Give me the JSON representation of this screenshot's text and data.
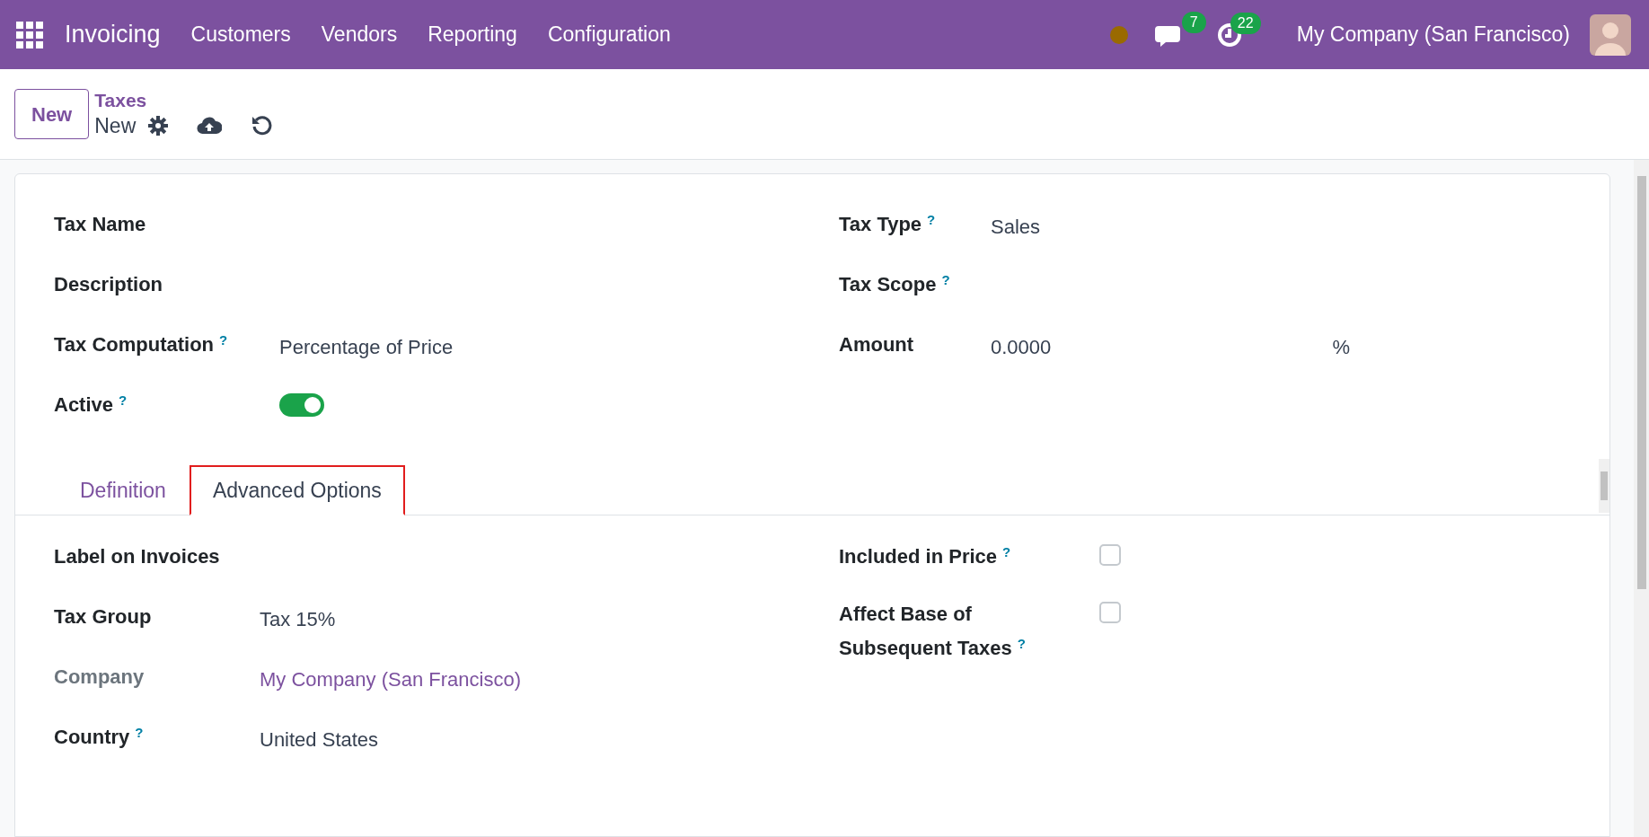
{
  "navbar": {
    "app_name": "Invoicing",
    "menu": [
      "Customers",
      "Vendors",
      "Reporting",
      "Configuration"
    ],
    "messages_count": "7",
    "activities_count": "22",
    "company": "My Company (San Francisco)"
  },
  "control_panel": {
    "new_button": "New",
    "breadcrumb": "Taxes",
    "record": "New"
  },
  "fields_left": [
    {
      "kind": "empty",
      "label": "Tax Name"
    },
    {
      "kind": "empty",
      "label": "Description"
    },
    {
      "kind": "text",
      "label": "Tax Computation",
      "help": "?",
      "value": "Percentage of Price"
    },
    {
      "kind": "toggle",
      "label": "Active",
      "help": "?",
      "on": true
    }
  ],
  "fields_right": [
    {
      "kind": "text",
      "label": "Tax Type",
      "help": "?",
      "value": "Sales"
    },
    {
      "kind": "empty",
      "label": "Tax Scope",
      "help": "?"
    },
    {
      "kind": "amount",
      "label": "Amount",
      "value": "0.0000",
      "unit": "%"
    }
  ],
  "tabs": [
    {
      "label": "Definition",
      "selected": false
    },
    {
      "label": "Advanced Options",
      "selected": true
    }
  ],
  "tab_fields_left": [
    {
      "kind": "empty",
      "label": "Label on Invoices",
      "muted": false
    },
    {
      "kind": "text",
      "label": "Tax Group",
      "value": "Tax 15%",
      "muted": false
    },
    {
      "kind": "link",
      "label": "Company",
      "value": "My Company (San Francisco)",
      "muted": true
    },
    {
      "kind": "text",
      "label": "Country",
      "help": "?",
      "value": "United States",
      "muted": false
    }
  ],
  "tab_fields_right": [
    {
      "kind": "checkbox",
      "label": "Included in Price",
      "help": "?",
      "checked": false
    },
    {
      "kind": "checkbox",
      "label": "Affect Base of Subsequent Taxes",
      "help": "?",
      "checked": false
    }
  ]
}
